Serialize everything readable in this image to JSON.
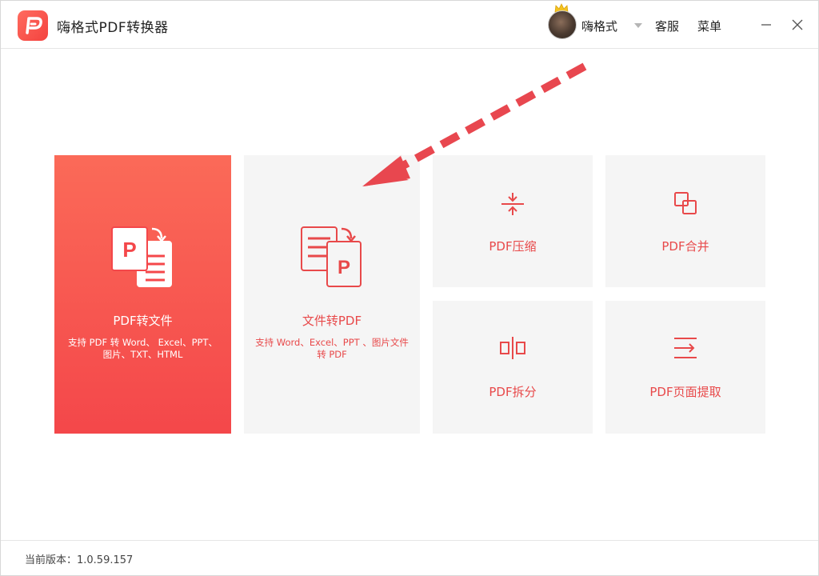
{
  "app": {
    "title": "嗨格式PDF转换器",
    "brand_color": "#f4433f"
  },
  "header": {
    "username": "嗨格式",
    "support_label": "客服",
    "menu_label": "菜单"
  },
  "cards": {
    "pdf_to_file": {
      "title": "PDF转文件",
      "desc": "支持 PDF 转 Word、 Excel、PPT、图片、TXT、HTML",
      "icon": "pdf-to-file-icon"
    },
    "file_to_pdf": {
      "title": "文件转PDF",
      "desc": "支持 Word、Excel、PPT 、图片文件转 PDF",
      "icon": "file-to-pdf-icon"
    },
    "compress": {
      "title": "PDF压缩",
      "icon": "compress-icon"
    },
    "merge": {
      "title": "PDF合并",
      "icon": "merge-icon"
    },
    "split": {
      "title": "PDF拆分",
      "icon": "split-icon"
    },
    "extract": {
      "title": "PDF页面提取",
      "icon": "extract-page-icon"
    }
  },
  "footer": {
    "version_text": "当前版本：1.0.59.157"
  },
  "colors": {
    "accent": "#e8494a",
    "card_bg": "#f5f5f5",
    "primary_card_top": "#fb6a58",
    "primary_card_bottom": "#f4474a",
    "arrow": "#e8474f"
  }
}
